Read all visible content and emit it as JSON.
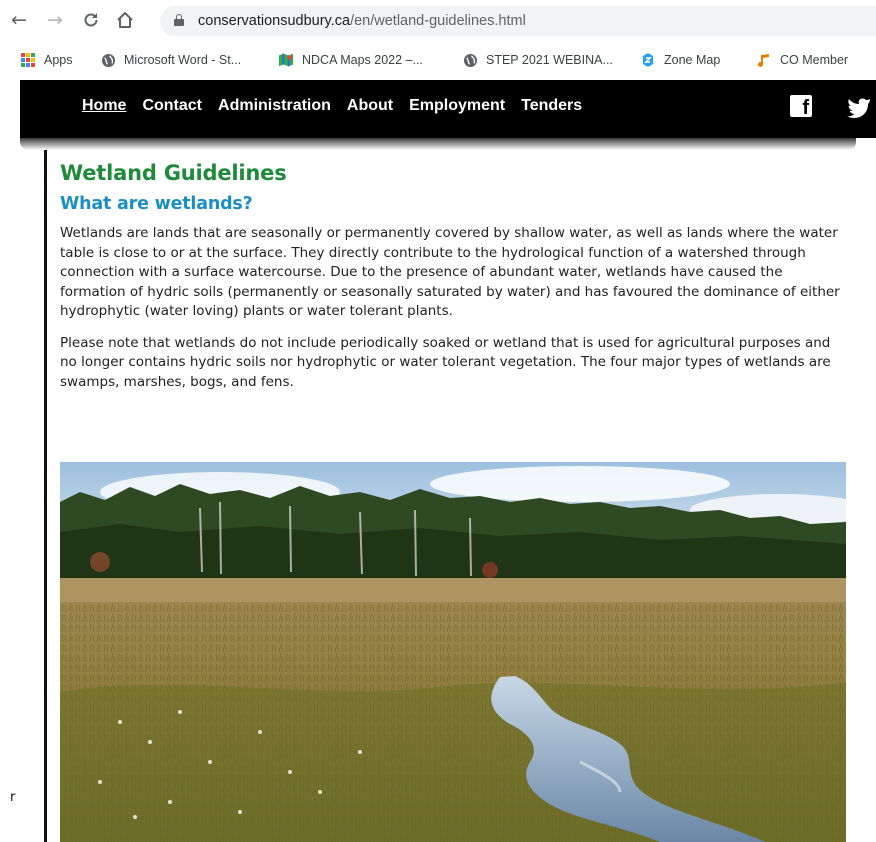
{
  "browser": {
    "url_host": "conservationsudbury.ca",
    "url_path": "/en/wetland-guidelines.html",
    "bookmarks": [
      {
        "label": "Apps",
        "icon": "apps-grid-icon"
      },
      {
        "label": "Microsoft Word - St...",
        "icon": "globe-icon"
      },
      {
        "label": "NDCA Maps 2022 –...",
        "icon": "maps-icon"
      },
      {
        "label": "STEP 2021 WEBINA...",
        "icon": "globe-icon"
      },
      {
        "label": "Zone Map",
        "icon": "zone-map-icon"
      },
      {
        "label": "CO Member",
        "icon": "music-note-icon"
      }
    ]
  },
  "nav": {
    "items": [
      "Home",
      "Contact",
      "Administration",
      "About",
      "Employment",
      "Tenders"
    ],
    "social": [
      "facebook-icon",
      "twitter-icon"
    ]
  },
  "page": {
    "title": "Wetland Guidelines",
    "subtitle": "What are wetlands?",
    "paragraphs": [
      "Wetlands are lands that are seasonally or permanently covered by shallow water, as well as lands where the water table is close to or at the surface. They directly contribute to the hydrological function of a watershed through connection with a surface watercourse. Due to the presence of abundant water, wetlands have caused the formation of hydric soils (permanently or seasonally saturated by water) and has favoured the dominance of either hydrophytic (water loving) plants or water tolerant plants.",
      "Please note that wetlands do not include periodically soaked or wetland that is used for agricultural purposes and no longer contains hydric soils nor hydrophytic or water tolerant vegetation. The four major types of wetlands are swamps, marshes, bogs, and fens."
    ],
    "stray_glyph": "r"
  },
  "colors": {
    "title_green": "#1f8a3b",
    "subtitle_blue": "#1b8fc4",
    "nav_bg": "#000000"
  }
}
